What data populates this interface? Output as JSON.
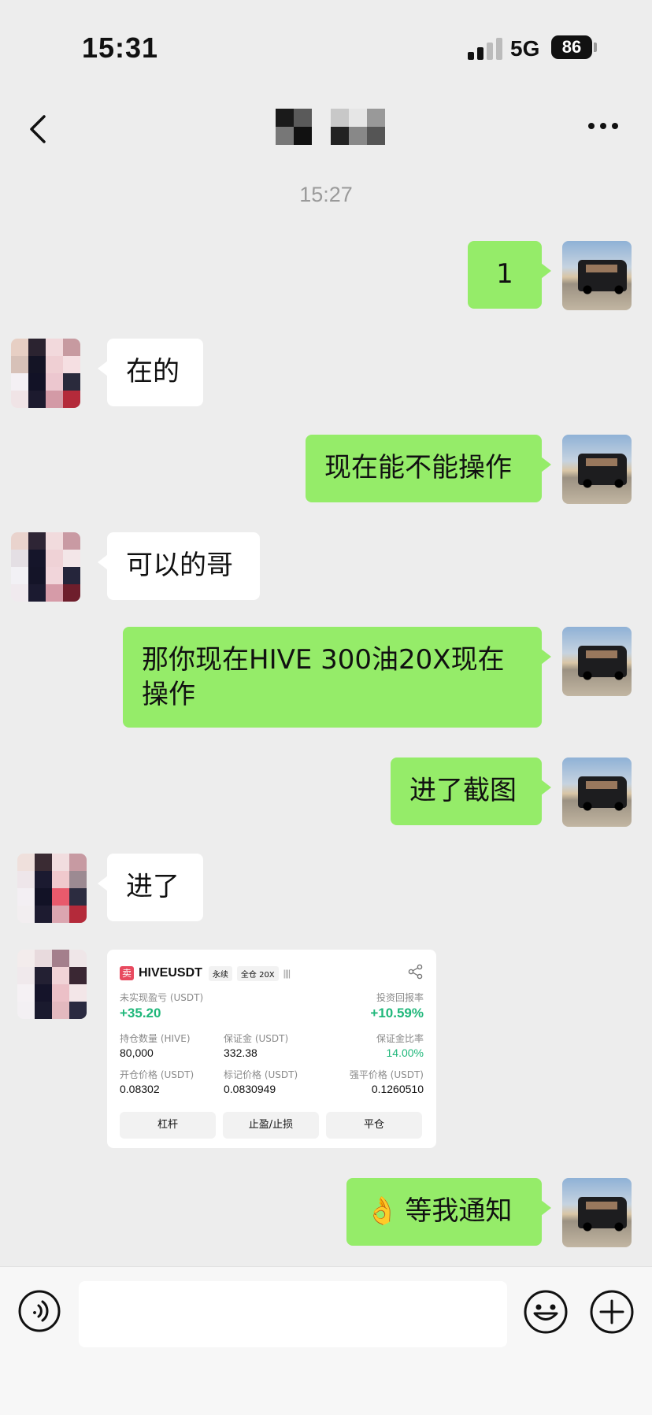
{
  "status_bar": {
    "time": "15:31",
    "network": "5G",
    "battery": "86"
  },
  "chat": {
    "timestamp": "15:27"
  },
  "messages": [
    {
      "from": "me",
      "text": "1"
    },
    {
      "from": "other",
      "text": "在的"
    },
    {
      "from": "me",
      "text": "现在能不能操作"
    },
    {
      "from": "other",
      "text": "可以的哥"
    },
    {
      "from": "me",
      "text": "那你现在HIVE 300油20X现在操作"
    },
    {
      "from": "me",
      "text": "进了截图"
    },
    {
      "from": "other",
      "text": "进了"
    },
    {
      "from": "me",
      "text": "等我通知",
      "emoji": "👌"
    }
  ],
  "trade_card": {
    "side_tag": "卖",
    "pair": "HIVEUSDT",
    "type_chip": "永续",
    "margin_chip": "全仓 20X",
    "signal_bars": "||||",
    "unrealized_pnl_label": "未实现盈亏 (USDT)",
    "unrealized_pnl": "+35.20",
    "roi_label": "投资回报率",
    "roi": "+10.59%",
    "position_label": "持仓数量 (HIVE)",
    "position": "80,000",
    "margin_label": "保证金 (USDT)",
    "margin": "332.38",
    "margin_ratio_label": "保证金比率",
    "margin_ratio": "14.00%",
    "entry_price_label": "开仓价格 (USDT)",
    "entry_price": "0.08302",
    "mark_price_label": "标记价格 (USDT)",
    "mark_price": "0.0830949",
    "liq_price_label": "强平价格 (USDT)",
    "liq_price": "0.1260510",
    "buttons": [
      "杠杆",
      "止盈/止损",
      "平仓"
    ]
  },
  "icons": {
    "back": "chevron-left-icon",
    "more": "more-icon",
    "voice": "voice-icon",
    "emoji": "emoji-icon",
    "plus": "plus-icon",
    "share": "share-icon"
  },
  "colors": {
    "my_bubble": "#95ec69",
    "other_bubble": "#ffffff",
    "background": "#ededed",
    "profit_green": "#1fb77a",
    "sell_red": "#e84a5f"
  }
}
